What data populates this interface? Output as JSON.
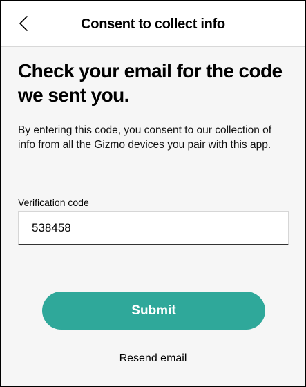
{
  "header": {
    "title": "Consent to collect info",
    "back_icon": "chevron-left-icon"
  },
  "main": {
    "headline": "Check your email for the code we sent you.",
    "description": "By entering this code, you consent to our collection of info from all the Gizmo devices you pair with this app.",
    "verification_field": {
      "label": "Verification code",
      "value": "538458"
    },
    "submit_label": "Submit",
    "resend_label": "Resend email"
  },
  "colors": {
    "accent": "#2fa89a",
    "caret": "#4a6ff0",
    "background": "#f6f6f6"
  }
}
